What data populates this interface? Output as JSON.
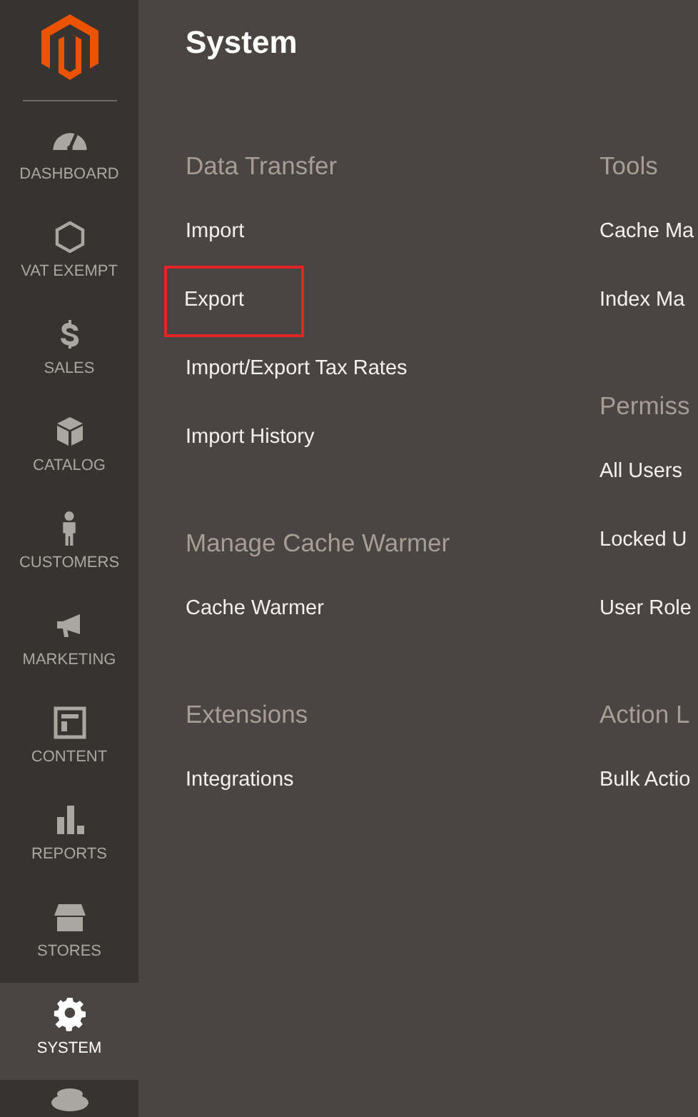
{
  "sidebar": {
    "items": [
      {
        "label": "DASHBOARD",
        "selected": false
      },
      {
        "label": "VAT EXEMPT",
        "selected": false
      },
      {
        "label": "SALES",
        "selected": false
      },
      {
        "label": "CATALOG",
        "selected": false
      },
      {
        "label": "CUSTOMERS",
        "selected": false
      },
      {
        "label": "MARKETING",
        "selected": false
      },
      {
        "label": "CONTENT",
        "selected": false
      },
      {
        "label": "REPORTS",
        "selected": false
      },
      {
        "label": "STORES",
        "selected": false
      },
      {
        "label": "SYSTEM",
        "selected": true
      }
    ]
  },
  "page": {
    "title": "System",
    "columns": [
      [
        {
          "heading": "Data Transfer",
          "items": [
            {
              "label": "Import",
              "highlighted": false
            },
            {
              "label": "Export",
              "highlighted": true
            },
            {
              "label": "Import/Export Tax Rates",
              "highlighted": false
            },
            {
              "label": "Import History",
              "highlighted": false
            }
          ]
        },
        {
          "heading": "Manage Cache Warmer",
          "items": [
            {
              "label": "Cache Warmer",
              "highlighted": false
            }
          ]
        },
        {
          "heading": "Extensions",
          "items": [
            {
              "label": "Integrations",
              "highlighted": false
            }
          ]
        }
      ],
      [
        {
          "heading": "Tools",
          "items": [
            {
              "label": "Cache Ma",
              "highlighted": false
            },
            {
              "label": "Index Ma",
              "highlighted": false
            }
          ]
        },
        {
          "heading": "Permiss",
          "items": [
            {
              "label": "All Users",
              "highlighted": false
            },
            {
              "label": "Locked U",
              "highlighted": false
            },
            {
              "label": "User Role",
              "highlighted": false
            }
          ]
        },
        {
          "heading": "Action L",
          "items": [
            {
              "label": "Bulk Actio",
              "highlighted": false
            }
          ]
        }
      ]
    ]
  }
}
